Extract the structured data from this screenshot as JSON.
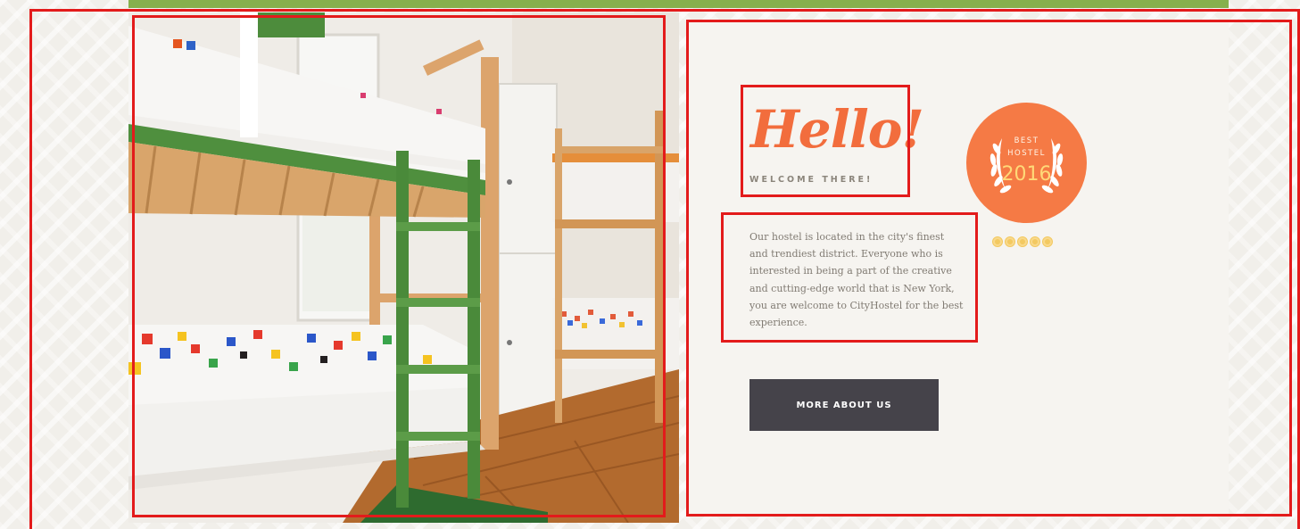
{
  "welcome": {
    "heading": "Hello!",
    "subheading": "WELCOME THERE!",
    "description": "Our hostel is located in the city's finest and trendiest district. Everyone who is interested in being a part of the creative and cutting-edge world that is New York, you are welcome to CityHostel for the best experience.",
    "button_label": "MORE ABOUT US"
  },
  "badge": {
    "line1": "BEST",
    "line2": "HOSTEL",
    "year": "2016",
    "rating_stars": 5
  },
  "colors": {
    "accent_orange": "#f26d3d",
    "badge_orange": "#f57a45",
    "top_bar_green": "#86b04d",
    "button_dark": "#45434a",
    "annotation_red": "#e31b1b"
  },
  "image": {
    "subject": "bunk beds in a hostel dormitory"
  }
}
